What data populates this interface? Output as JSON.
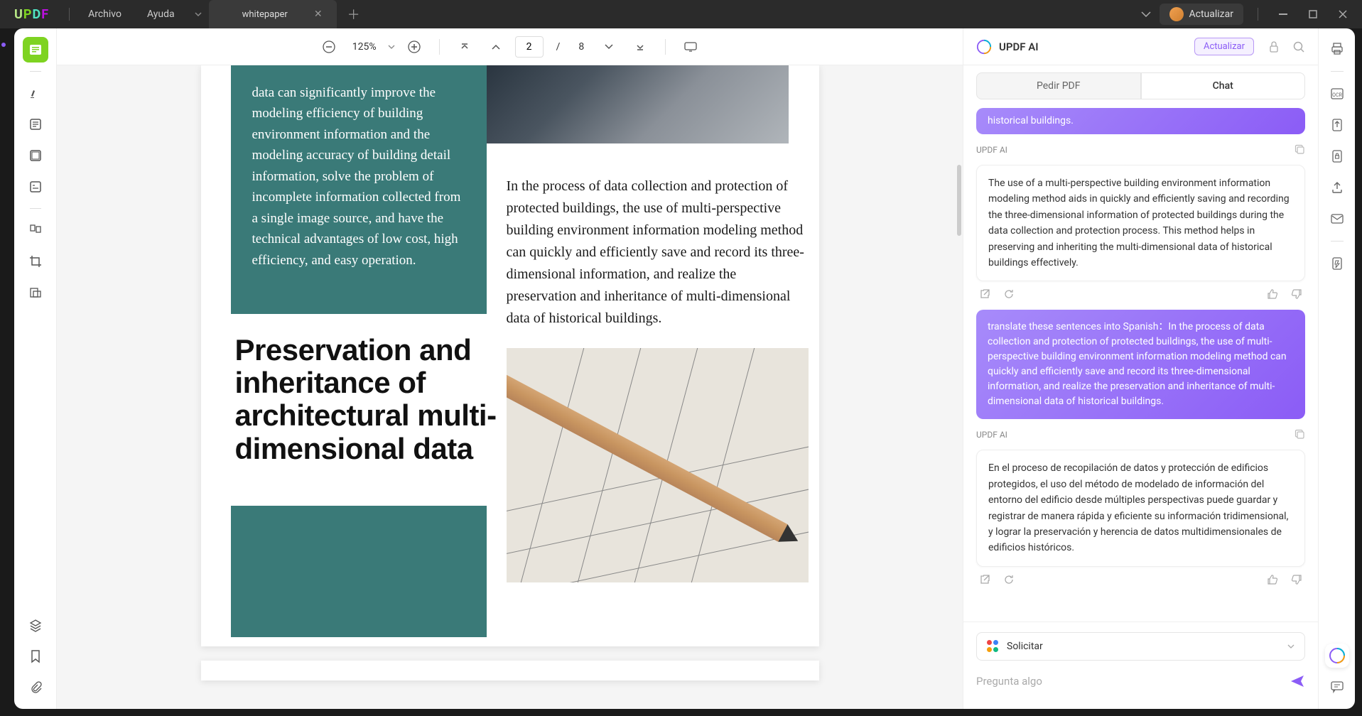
{
  "titlebar": {
    "logo": "UPDF",
    "menu": {
      "file": "Archivo",
      "help": "Ayuda"
    },
    "tab_title": "whitepaper",
    "upgrade": "Actualizar"
  },
  "toolbar": {
    "zoom": "125%",
    "page_current": "2",
    "page_sep": "/",
    "page_total": "8"
  },
  "document": {
    "teal_text": "data can significantly improve the modeling efficiency of building environment information and the modeling accuracy of building detail information, solve the problem of incomplete information collected from a single image source, and have the technical advantages of low cost, high efficiency, and easy operation.",
    "body_text": "In the process of data collection and protection of protected buildings, the use of multi-perspective building environment information modeling method can quickly and efficiently save and record its three-dimensional information, and realize the preservation and inheritance of multi-dimensional data of historical buildings.",
    "heading": "Preservation and inheritance of architectural multi-dimensional data"
  },
  "ai": {
    "title": "UPDF AI",
    "upgrade": "Actualizar",
    "tabs": {
      "pdf": "Pedir PDF",
      "chat": "Chat"
    },
    "msg_trunc": "historical buildings.",
    "label": "UPDF AI",
    "msg1": "The use of a multi-perspective building environment information modeling method aids in quickly and efficiently saving and recording the three-dimensional information of protected buildings during the data collection and protection process. This method helps in preserving and inheriting the multi-dimensional data of historical buildings effectively.",
    "msg_user2": "translate these sentences into Spanish：In the process of data collection and protection of protected buildings, the use of multi-perspective building environment information modeling method can quickly and efficiently save and record its three-dimensional information, and realize the preservation and inheritance of multi-dimensional data of historical buildings.",
    "msg2": "En el proceso de recopilación de datos y protección de edificios protegidos, el uso del método de modelado de información del entorno del edificio desde múltiples perspectivas puede guardar y registrar de manera rápida y eficiente su información tridimensional, y lograr la preservación y herencia de datos multidimensionales de edificios históricos.",
    "solicitar": "Solicitar",
    "placeholder": "Pregunta algo"
  }
}
